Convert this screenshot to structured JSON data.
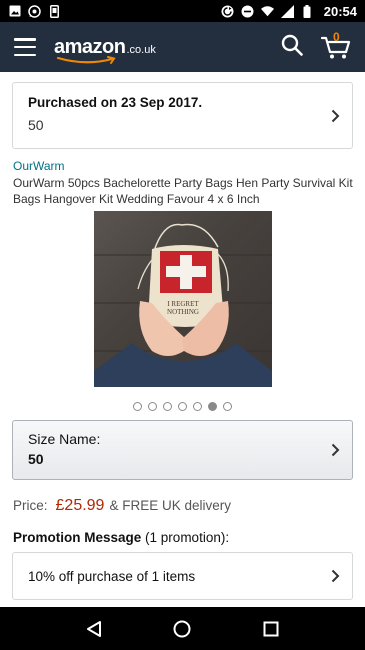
{
  "status_bar": {
    "time": "20:54",
    "icons_left": [
      "image-icon",
      "whatsapp-icon",
      "phone-icon"
    ],
    "icons_right": [
      "sync-icon",
      "dnd-icon",
      "wifi-icon",
      "signal-icon",
      "battery-icon"
    ]
  },
  "header": {
    "logo_text": "amazon",
    "logo_tld": ".co.uk",
    "cart_count": "0",
    "colors": {
      "background": "#232f3e",
      "accent": "#f08804"
    }
  },
  "purchase": {
    "title": "Purchased on 23 Sep 2017.",
    "quantity": "50"
  },
  "product": {
    "brand": "OurWarm",
    "title": "OurWarm 50pcs Bachelorette Party Bags Hen Party Survival Kit Bags Hangover Kit Wedding Favour 4 x 6 Inch",
    "image_caption": "I REGRET NOTHING",
    "carousel": {
      "count": 7,
      "active_index": 5
    }
  },
  "size": {
    "label": "Size Name:",
    "value": "50"
  },
  "price": {
    "label": "Price:",
    "amount": "£25.99",
    "delivery": "& FREE UK delivery",
    "color": "#b12704"
  },
  "promotion": {
    "heading": "Promotion Message",
    "count_text": "(1 promotion):",
    "item": "10% off purchase of 1 items"
  },
  "nav": {
    "buttons": [
      "back-icon",
      "home-icon",
      "recents-icon"
    ]
  }
}
